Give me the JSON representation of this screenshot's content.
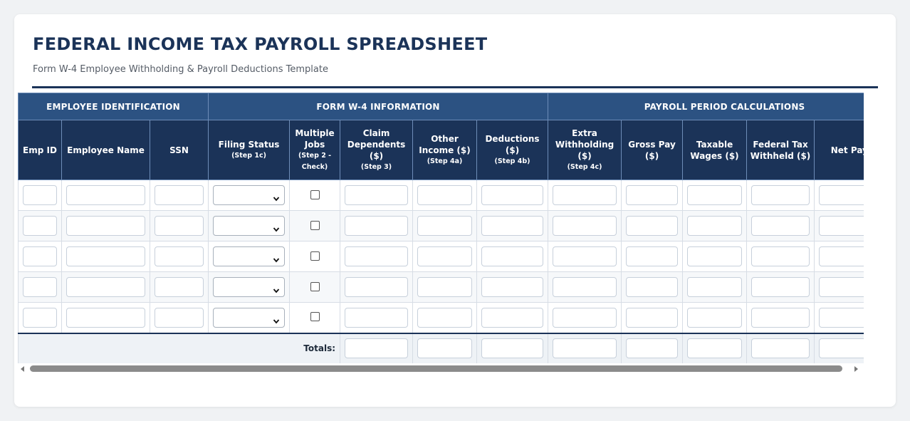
{
  "page": {
    "title": "FEDERAL INCOME TAX PAYROLL SPREADSHEET",
    "subtitle": "Form W-4 Employee Withholding & Payroll Deductions Template"
  },
  "table": {
    "groups": [
      {
        "label": "EMPLOYEE IDENTIFICATION"
      },
      {
        "label": "FORM W-4 INFORMATION"
      },
      {
        "label": "PAYROLL PERIOD CALCULATIONS"
      }
    ],
    "columns": [
      {
        "label": "Emp ID",
        "step": ""
      },
      {
        "label": "Employee Name",
        "step": ""
      },
      {
        "label": "SSN",
        "step": ""
      },
      {
        "label": "Filing Status",
        "step": "(Step 1c)"
      },
      {
        "label": "Multiple Jobs",
        "step": "(Step 2 - Check)"
      },
      {
        "label": "Claim Dependents ($)",
        "step": "(Step 3)"
      },
      {
        "label": "Other Income ($)",
        "step": "(Step 4a)"
      },
      {
        "label": "Deductions ($)",
        "step": "(Step 4b)"
      },
      {
        "label": "Extra Withholding ($)",
        "step": "(Step 4c)"
      },
      {
        "label": "Gross Pay ($)",
        "step": ""
      },
      {
        "label": "Taxable Wages ($)",
        "step": ""
      },
      {
        "label": "Federal Tax Withheld ($)",
        "step": ""
      },
      {
        "label": "Net Pay ($)",
        "step": ""
      }
    ],
    "rows": [
      {
        "emp_id": "",
        "name": "",
        "ssn": "",
        "filing_status": "",
        "multiple_jobs": false,
        "dependents": "",
        "other_income": "",
        "deductions": "",
        "extra_withholding": "",
        "gross_pay": "",
        "taxable_wages": "",
        "fed_tax": "",
        "net_pay": ""
      },
      {
        "emp_id": "",
        "name": "",
        "ssn": "",
        "filing_status": "",
        "multiple_jobs": false,
        "dependents": "",
        "other_income": "",
        "deductions": "",
        "extra_withholding": "",
        "gross_pay": "",
        "taxable_wages": "",
        "fed_tax": "",
        "net_pay": ""
      },
      {
        "emp_id": "",
        "name": "",
        "ssn": "",
        "filing_status": "",
        "multiple_jobs": false,
        "dependents": "",
        "other_income": "",
        "deductions": "",
        "extra_withholding": "",
        "gross_pay": "",
        "taxable_wages": "",
        "fed_tax": "",
        "net_pay": ""
      },
      {
        "emp_id": "",
        "name": "",
        "ssn": "",
        "filing_status": "",
        "multiple_jobs": false,
        "dependents": "",
        "other_income": "",
        "deductions": "",
        "extra_withholding": "",
        "gross_pay": "",
        "taxable_wages": "",
        "fed_tax": "",
        "net_pay": ""
      },
      {
        "emp_id": "",
        "name": "",
        "ssn": "",
        "filing_status": "",
        "multiple_jobs": false,
        "dependents": "",
        "other_income": "",
        "deductions": "",
        "extra_withholding": "",
        "gross_pay": "",
        "taxable_wages": "",
        "fed_tax": "",
        "net_pay": ""
      }
    ],
    "totals_label": "Totals:"
  },
  "icons": {
    "select_chevron": "chevron-down-icon",
    "scroll_left": "scroll-left-arrow-icon",
    "scroll_right": "scroll-right-arrow-icon"
  },
  "colors": {
    "title": "#1b3358",
    "group_header": "#2c5282",
    "column_header": "#1b3358"
  }
}
